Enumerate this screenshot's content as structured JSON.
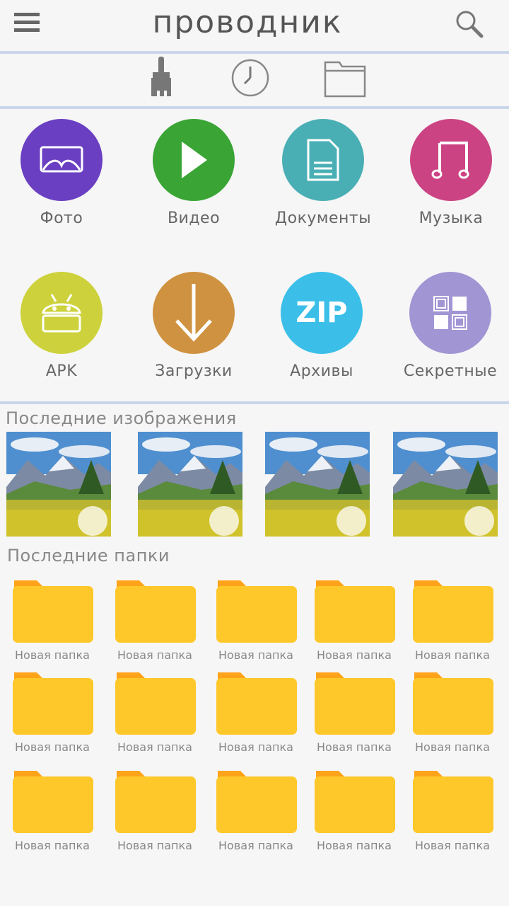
{
  "header": {
    "title": "проводник",
    "menu_icon": "hamburger-menu-icon",
    "search_icon": "search-icon"
  },
  "toolbar": {
    "items": [
      {
        "icon": "brush-icon"
      },
      {
        "icon": "clock-icon"
      },
      {
        "icon": "folder-icon"
      }
    ]
  },
  "categories": [
    {
      "label": "Фото",
      "icon": "photo-icon",
      "color": "#6a3fc2"
    },
    {
      "label": "Видео",
      "icon": "play-icon",
      "color": "#3aa535"
    },
    {
      "label": "Документы",
      "icon": "document-icon",
      "color": "#4aafb5"
    },
    {
      "label": "Музыка",
      "icon": "music-note-icon",
      "color": "#cc4383"
    },
    {
      "label": "APK",
      "icon": "android-icon",
      "color": "#cdd23c"
    },
    {
      "label": "Загрузки",
      "icon": "download-arrow-icon",
      "color": "#cf9240"
    },
    {
      "label": "Архивы",
      "icon": "zip-icon",
      "color": "#3bbfe8",
      "badge": "ZIP"
    },
    {
      "label": "Секретные",
      "icon": "secret-grid-icon",
      "color": "#a195d4"
    }
  ],
  "recent_images": {
    "title": "Последние изображения",
    "count": 4
  },
  "recent_folders": {
    "title": "Последние папки",
    "items": [
      "Новая папка",
      "Новая папка",
      "Новая папка",
      "Новая папка",
      "Новая папка",
      "Новая папка",
      "Новая папка",
      "Новая папка",
      "Новая папка",
      "Новая папка",
      "Новая папка",
      "Новая папка",
      "Новая папка",
      "Новая папка",
      "Новая папка"
    ]
  },
  "colors": {
    "separator": "#c9d6ea",
    "folder": "#ffc82a",
    "folder_tab": "#ffa31a"
  }
}
